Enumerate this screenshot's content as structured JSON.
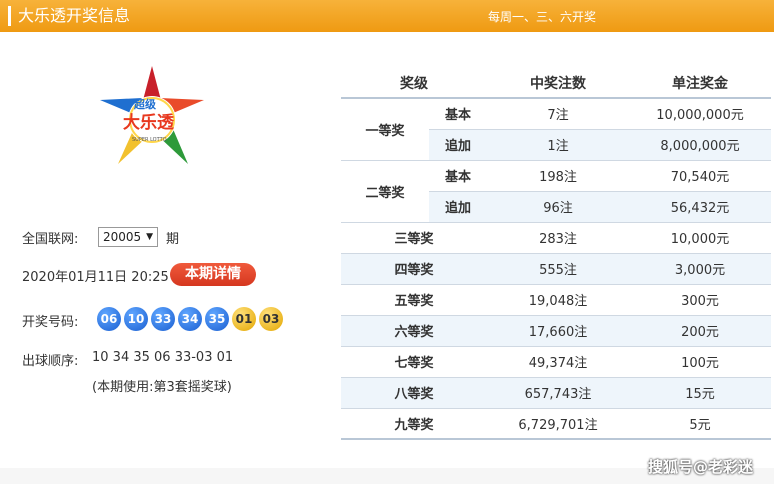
{
  "header": {
    "title": "大乐透开奖信息",
    "schedule": "每周一、三、六开奖"
  },
  "logo": {
    "text_top": "超级",
    "text_main": "大乐透",
    "text_en": "SUPER LOTTO"
  },
  "issue": {
    "label": "全国联网:",
    "selected": "20005",
    "suffix": "期"
  },
  "draw_time": "2020年01月11日 20:25",
  "detail_button": "本期详情",
  "numbers": {
    "label": "开奖号码:",
    "front": [
      "06",
      "10",
      "33",
      "34",
      "35"
    ],
    "back": [
      "01",
      "03"
    ]
  },
  "order": {
    "label": "出球顺序:",
    "value": "10 34 35 06 33-03 01",
    "note": "(本期使用:第3套摇奖球)"
  },
  "table": {
    "headers": [
      "奖级",
      "中奖注数",
      "单注奖金"
    ],
    "rows": [
      {
        "level": "一等奖",
        "sub": "基本",
        "count": "7注",
        "prize": "10,000,000元"
      },
      {
        "level": "",
        "sub": "追加",
        "count": "1注",
        "prize": "8,000,000元"
      },
      {
        "level": "二等奖",
        "sub": "基本",
        "count": "198注",
        "prize": "70,540元"
      },
      {
        "level": "",
        "sub": "追加",
        "count": "96注",
        "prize": "56,432元"
      },
      {
        "level": "三等奖",
        "sub": "",
        "count": "283注",
        "prize": "10,000元"
      },
      {
        "level": "四等奖",
        "sub": "",
        "count": "555注",
        "prize": "3,000元"
      },
      {
        "level": "五等奖",
        "sub": "",
        "count": "19,048注",
        "prize": "300元"
      },
      {
        "level": "六等奖",
        "sub": "",
        "count": "17,660注",
        "prize": "200元"
      },
      {
        "level": "七等奖",
        "sub": "",
        "count": "49,374注",
        "prize": "100元"
      },
      {
        "level": "八等奖",
        "sub": "",
        "count": "657,743注",
        "prize": "15元"
      },
      {
        "level": "九等奖",
        "sub": "",
        "count": "6,729,701注",
        "prize": "5元"
      }
    ]
  },
  "watermark": "搜狐号@老彩迷",
  "colors": {
    "header": "#f0a020",
    "front_ball": "#1b5fd1",
    "back_ball": "#e3a600",
    "detail_button": "#e0452a"
  }
}
